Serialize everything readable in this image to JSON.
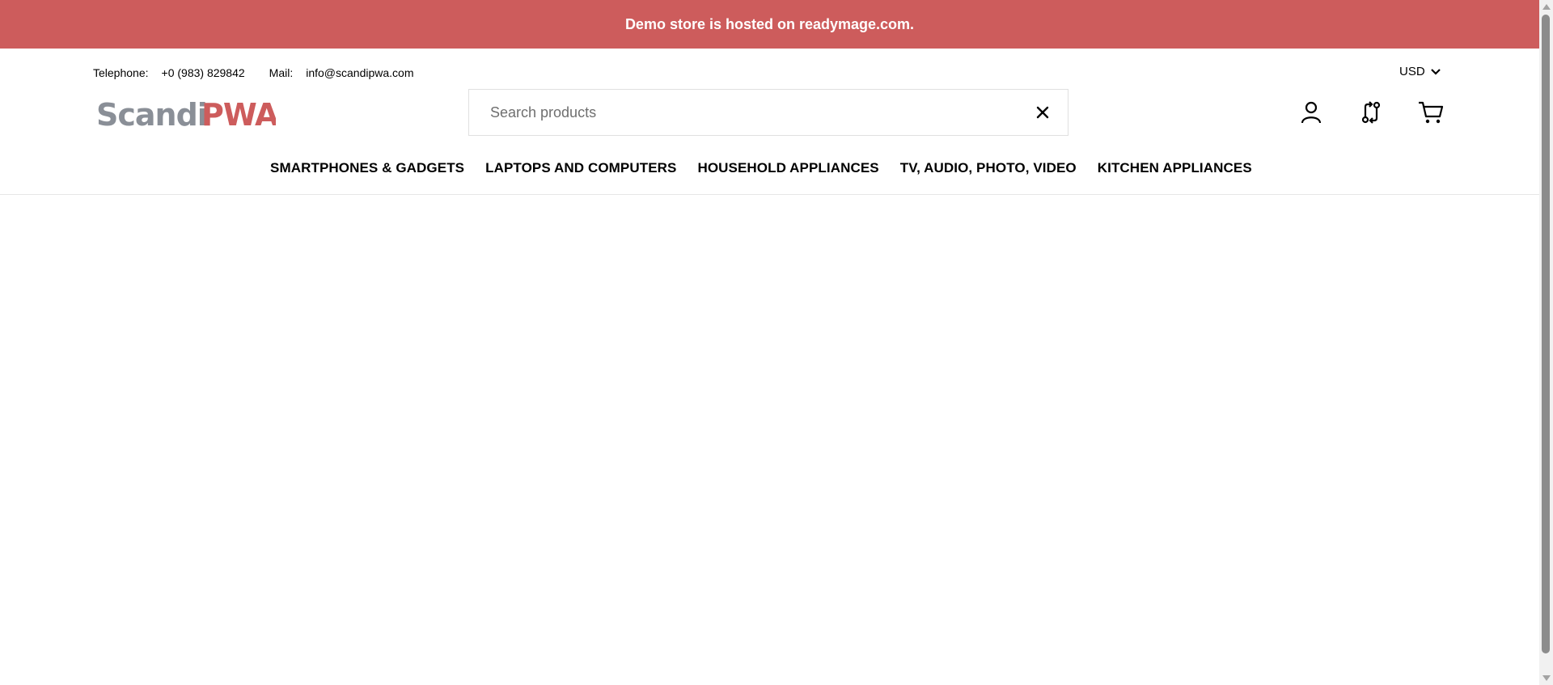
{
  "banner": {
    "text": "Demo store is hosted on readymage.com.",
    "background": "#cd5c5c"
  },
  "contact": {
    "telephone_label": "Telephone:",
    "telephone_value": "+0 (983) 829842",
    "mail_label": "Mail:",
    "mail_value": "info@scandipwa.com"
  },
  "currency": {
    "selected": "USD"
  },
  "logo": {
    "part1": "Scandi",
    "part2": "PWA",
    "part1_color": "#8a8f97",
    "part2_color": "#cd5c5c"
  },
  "search": {
    "placeholder": "Search products",
    "value": ""
  },
  "header_icons": [
    "account-icon",
    "compare-icon",
    "cart-icon"
  ],
  "nav": {
    "items": [
      "SMARTPHONES & GADGETS",
      "LAPTOPS AND COMPUTERS",
      "HOUSEHOLD APPLIANCES",
      "TV, AUDIO, PHOTO, VIDEO",
      "KITCHEN APPLIANCES"
    ]
  }
}
